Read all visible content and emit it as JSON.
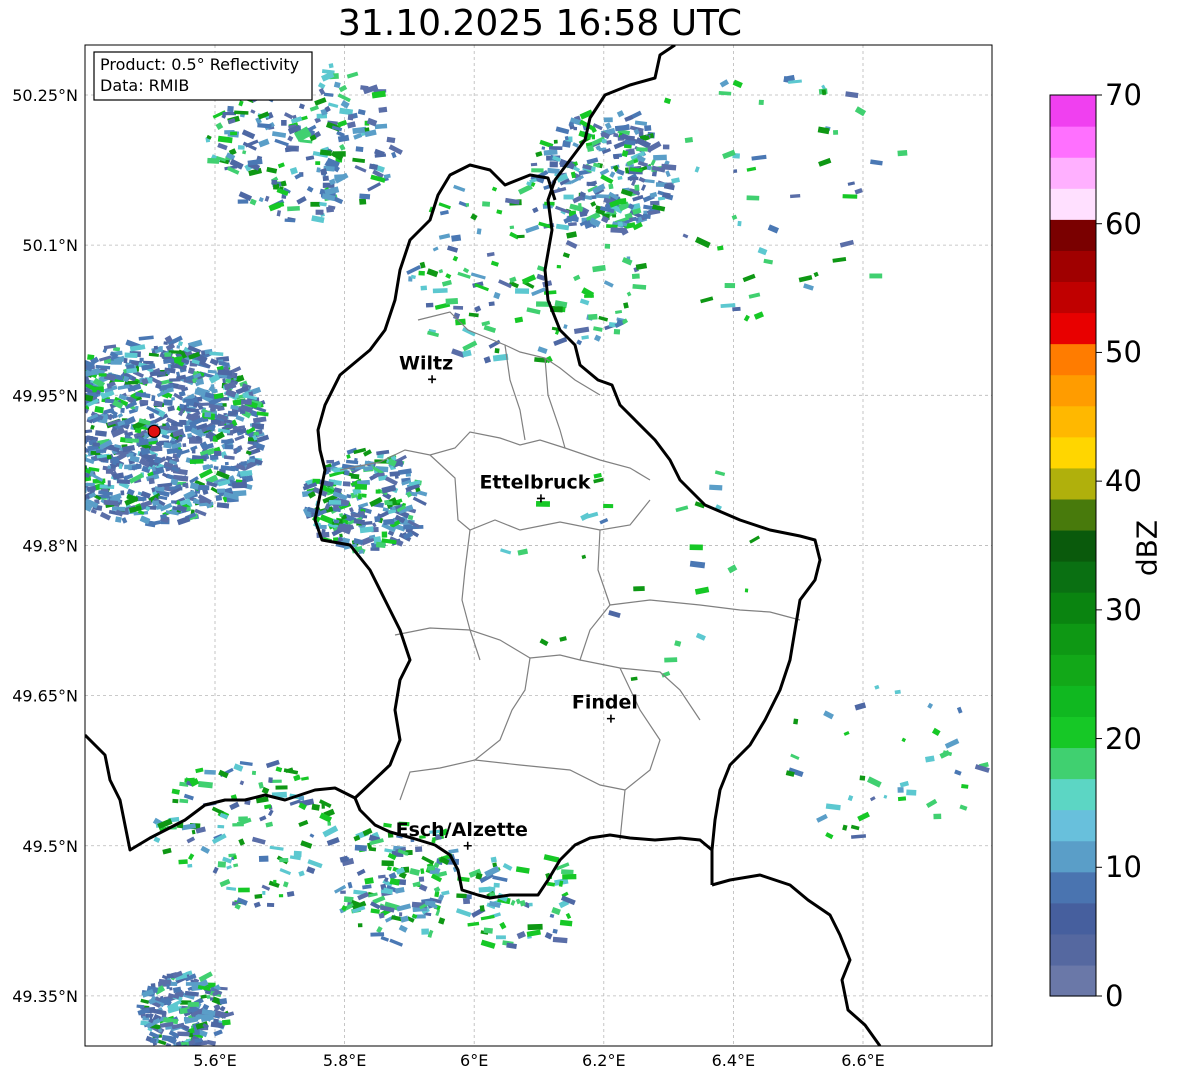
{
  "title": "31.10.2025 16:58 UTC",
  "info_box": {
    "product": "Product: 0.5° Reflectivity",
    "source": "Data: RMIB"
  },
  "axes": {
    "lon_ticks": [
      "5.6°E",
      "5.8°E",
      "6°E",
      "6.2°E",
      "6.4°E",
      "6.6°E"
    ],
    "lat_ticks": [
      "50.25°N",
      "50.1°N",
      "49.95°N",
      "49.8°N",
      "49.65°N",
      "49.5°N",
      "49.35°N"
    ]
  },
  "cities": [
    {
      "name": "Wiltz",
      "lon": 5.935,
      "lat": 49.966
    },
    {
      "name": "Ettelbruck",
      "lon": 6.103,
      "lat": 49.847
    },
    {
      "name": "Findel",
      "lon": 6.211,
      "lat": 49.627
    },
    {
      "name": "Esch/Alzette",
      "lon": 5.99,
      "lat": 49.5
    }
  ],
  "radar_site": {
    "lon": 5.506,
    "lat": 49.914
  },
  "colorbar": {
    "label": "dBZ",
    "ticks": [
      "0",
      "10",
      "20",
      "30",
      "40",
      "50",
      "60",
      "70"
    ],
    "colors": [
      "#6a78a8",
      "#5568a0",
      "#465f9e",
      "#4a74b0",
      "#5a9ec8",
      "#68c0dc",
      "#5cd6c4",
      "#40d070",
      "#16c826",
      "#10b820",
      "#12a818",
      "#0e9814",
      "#0a8410",
      "#0a7012",
      "#0a5a0c",
      "#487a0c",
      "#b0b00c",
      "#ffd600",
      "#ffb800",
      "#ff9c00",
      "#ff7c00",
      "#e80000",
      "#c00000",
      "#a00000",
      "#7a0000",
      "#ffe0ff",
      "#ffb0ff",
      "#ff70ff",
      "#f040f0"
    ]
  },
  "colors": {
    "border": "#000000",
    "cantons": "#808080",
    "grid": "#b8b8b8",
    "radar_marker": "#e01010"
  }
}
